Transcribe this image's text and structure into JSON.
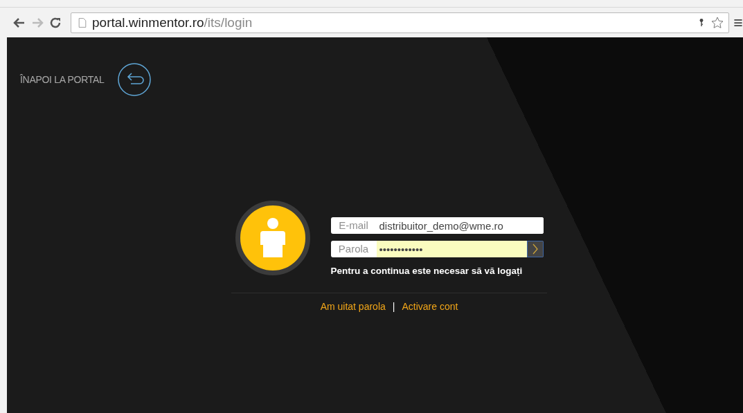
{
  "browser": {
    "url_host": "portal.winmentor.ro",
    "url_path": "/its/login"
  },
  "back_link": {
    "label": "ÎNAPOI LA PORTAL"
  },
  "login": {
    "email_label": "E-mail",
    "email_value": "distribuitor_demo@wme.ro",
    "password_label": "Parola",
    "password_value": "••••••••••••",
    "password_autofilled": true,
    "message": "Pentru a continua este necesar să vă logați"
  },
  "links": [
    {
      "label": "Am uitat parola"
    },
    {
      "label": "Activare cont"
    }
  ],
  "link_separator": "|"
}
